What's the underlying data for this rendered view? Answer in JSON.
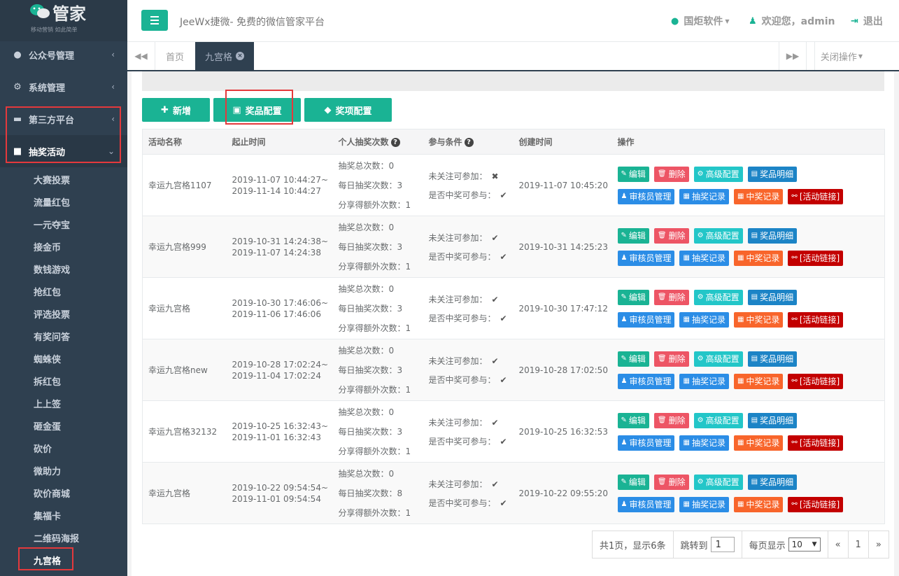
{
  "brand": {
    "name": "管家",
    "slogan": "移动营销  如此简单"
  },
  "sidebar": {
    "items": [
      {
        "label": "公众号管理",
        "icon": "wechat-icon",
        "arrow": "‹"
      },
      {
        "label": "系统管理",
        "icon": "gear-icon",
        "arrow": "‹"
      },
      {
        "label": "第三方平台",
        "icon": "cart-icon",
        "arrow": "‹"
      },
      {
        "label": "抽奖活动",
        "icon": "gift-icon",
        "arrow": "⌄"
      }
    ],
    "sub_items": [
      "大赛投票",
      "流量红包",
      "一元夺宝",
      "接金币",
      "数钱游戏",
      "抢红包",
      "评选投票",
      "有奖问答",
      "蜘蛛侠",
      "拆红包",
      "上上签",
      "砸金蛋",
      "砍价",
      "微助力",
      "砍价商城",
      "集福卡",
      "二维码海报",
      "九宫格"
    ]
  },
  "header": {
    "title": "JeeWx捷微- 免费的微信管家平台",
    "software": "国炬软件",
    "welcome": "欢迎您，admin",
    "logout": "退出"
  },
  "tabs": {
    "home": "首页",
    "current": "九宫格",
    "close_ops": "关闭操作"
  },
  "toolbar": {
    "add": "新增",
    "prize_config": "奖品配置",
    "award_config": "奖项配置"
  },
  "table": {
    "headers": [
      "活动名称",
      "起止时间",
      "个人抽奖次数",
      "参与条件",
      "创建时间",
      "操作"
    ],
    "labels": {
      "total": "抽奖总次数：",
      "daily": "每日抽奖次数：",
      "share": "分享得额外次数：",
      "unfollow": "未关注可参加：",
      "won": "是否中奖可参与："
    },
    "rows": [
      {
        "name": "幸运九宫格1107",
        "start": "2019-11-07 10:44:27~",
        "end": "2019-11-14 10:44:27",
        "total": "0",
        "daily": "3",
        "share": "1",
        "unfollow": "✖",
        "won": "✔",
        "created": "2019-11-07 10:45:20"
      },
      {
        "name": "幸运九宫格999",
        "start": "2019-10-31 14:24:38~",
        "end": "2019-11-07 14:24:38",
        "total": "0",
        "daily": "3",
        "share": "1",
        "unfollow": "✔",
        "won": "✔",
        "created": "2019-10-31 14:25:23"
      },
      {
        "name": "幸运九宫格",
        "start": "2019-10-30 17:46:06~",
        "end": "2019-11-06 17:46:06",
        "total": "0",
        "daily": "3",
        "share": "1",
        "unfollow": "✔",
        "won": "✔",
        "created": "2019-10-30 17:47:12"
      },
      {
        "name": "幸运九宫格new",
        "start": "2019-10-28 17:02:24~",
        "end": "2019-11-04 17:02:24",
        "total": "0",
        "daily": "3",
        "share": "1",
        "unfollow": "✔",
        "won": "✔",
        "created": "2019-10-28 17:02:50"
      },
      {
        "name": "幸运九宫格32132",
        "start": "2019-10-25 16:32:43~",
        "end": "2019-11-01 16:32:43",
        "total": "0",
        "daily": "3",
        "share": "1",
        "unfollow": "✔",
        "won": "✔",
        "created": "2019-10-25 16:32:53"
      },
      {
        "name": "幸运九宫格",
        "start": "2019-10-22 09:54:54~",
        "end": "2019-11-01 09:54:54",
        "total": "0",
        "daily": "8",
        "share": "1",
        "unfollow": "✔",
        "won": "✔",
        "created": "2019-10-22 09:55:20"
      }
    ],
    "actions": {
      "edit": "编辑",
      "delete": "删除",
      "advanced": "高级配置",
      "prize_detail": "奖品明细",
      "reviewer": "审核员管理",
      "draw_record": "抽奖记录",
      "win_record": "中奖记录",
      "link": "[活动链接]"
    }
  },
  "pager": {
    "summary": "共1页，显示6条",
    "jump_label": "跳转到",
    "jump_value": "1",
    "per_page_label": "每页显示",
    "per_page_value": "10",
    "prev": "«",
    "page": "1",
    "next": "»"
  }
}
